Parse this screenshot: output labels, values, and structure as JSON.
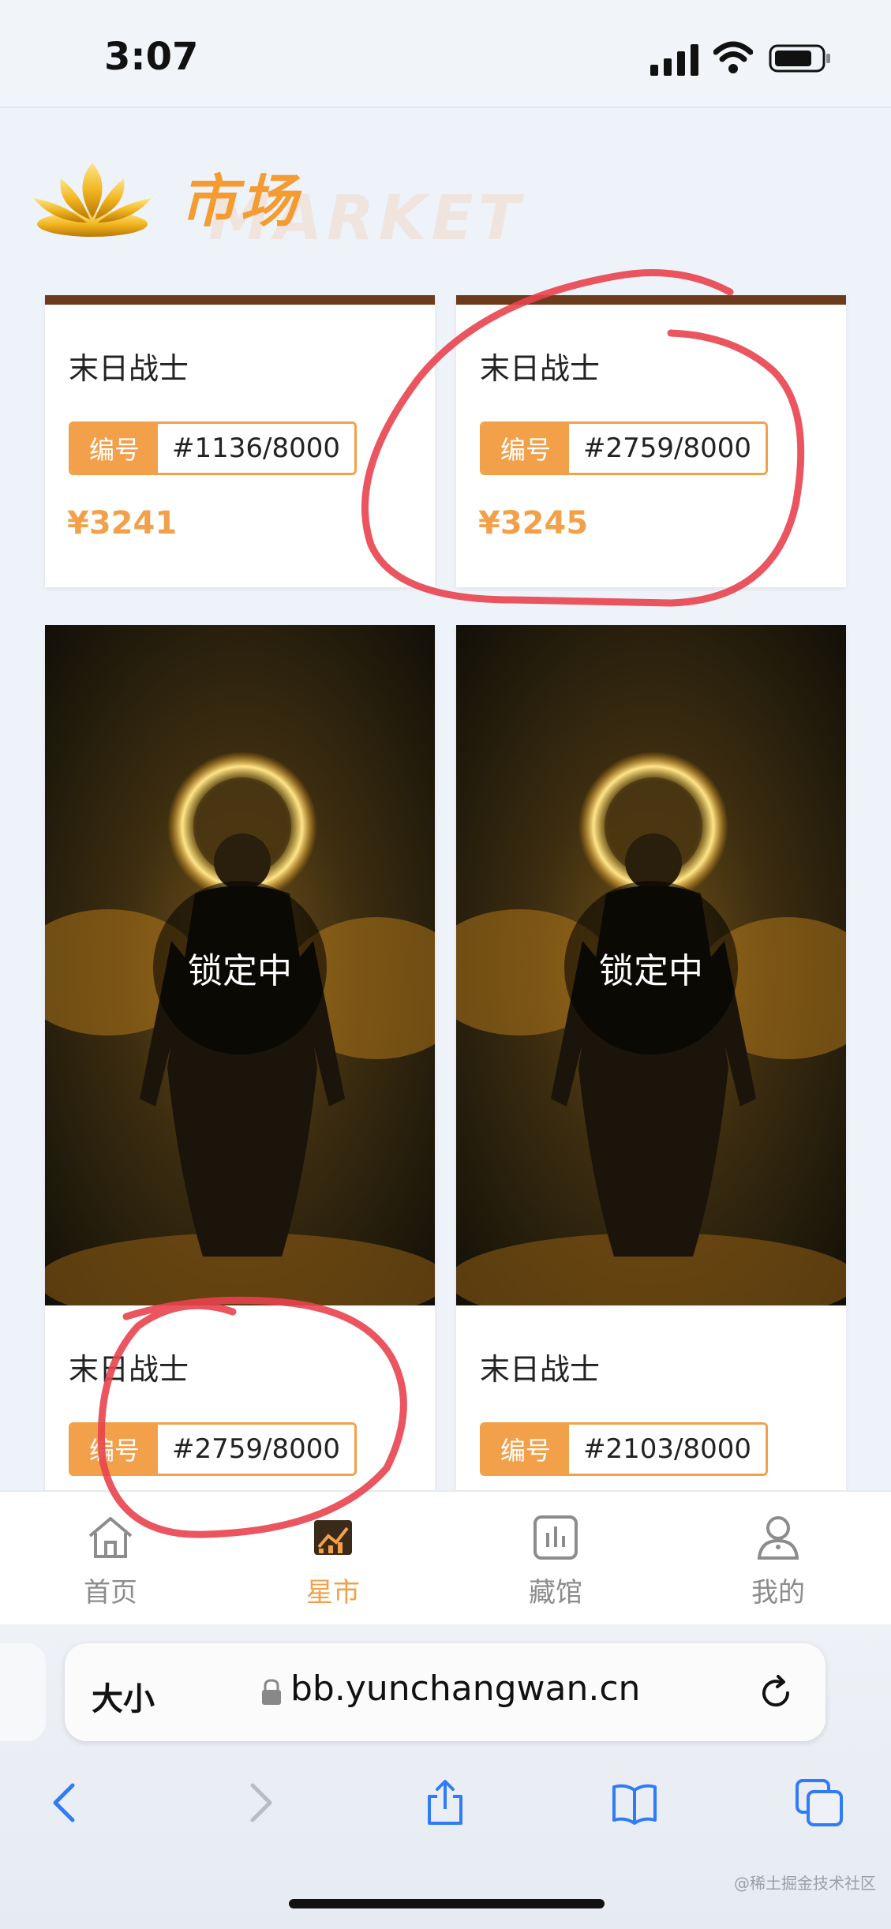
{
  "status_bar": {
    "time": "3:07"
  },
  "header": {
    "title": "市场",
    "watermark": "MARKET"
  },
  "cards": [
    {
      "name": "末日战士",
      "badge_label": "编号",
      "serial": "#1136/8000",
      "price": "¥3241"
    },
    {
      "name": "末日战士",
      "badge_label": "编号",
      "serial": "#2759/8000",
      "price": "¥3245"
    },
    {
      "name": "末日战士",
      "badge_label": "编号",
      "serial": "#2759/8000",
      "status": "锁定中"
    },
    {
      "name": "末日战士",
      "badge_label": "编号",
      "serial": "#2103/8000",
      "status": "锁定中"
    }
  ],
  "tab_bar": {
    "tabs": [
      {
        "label": "首页",
        "icon": "home-icon"
      },
      {
        "label": "星市",
        "icon": "market-chart-icon",
        "active": true
      },
      {
        "label": "藏馆",
        "icon": "collection-icon"
      },
      {
        "label": "我的",
        "icon": "profile-icon"
      }
    ]
  },
  "browser": {
    "text_size_label": "大小",
    "url": "bb.yunchangwan.cn",
    "toolbar_icons": [
      "back-icon",
      "forward-icon",
      "share-icon",
      "bookmarks-icon",
      "tabs-icon"
    ]
  },
  "watermark_credit": "@稀土掘金技术社区",
  "colors": {
    "accent": "#f2a14a",
    "annotation": "#e8424e"
  }
}
